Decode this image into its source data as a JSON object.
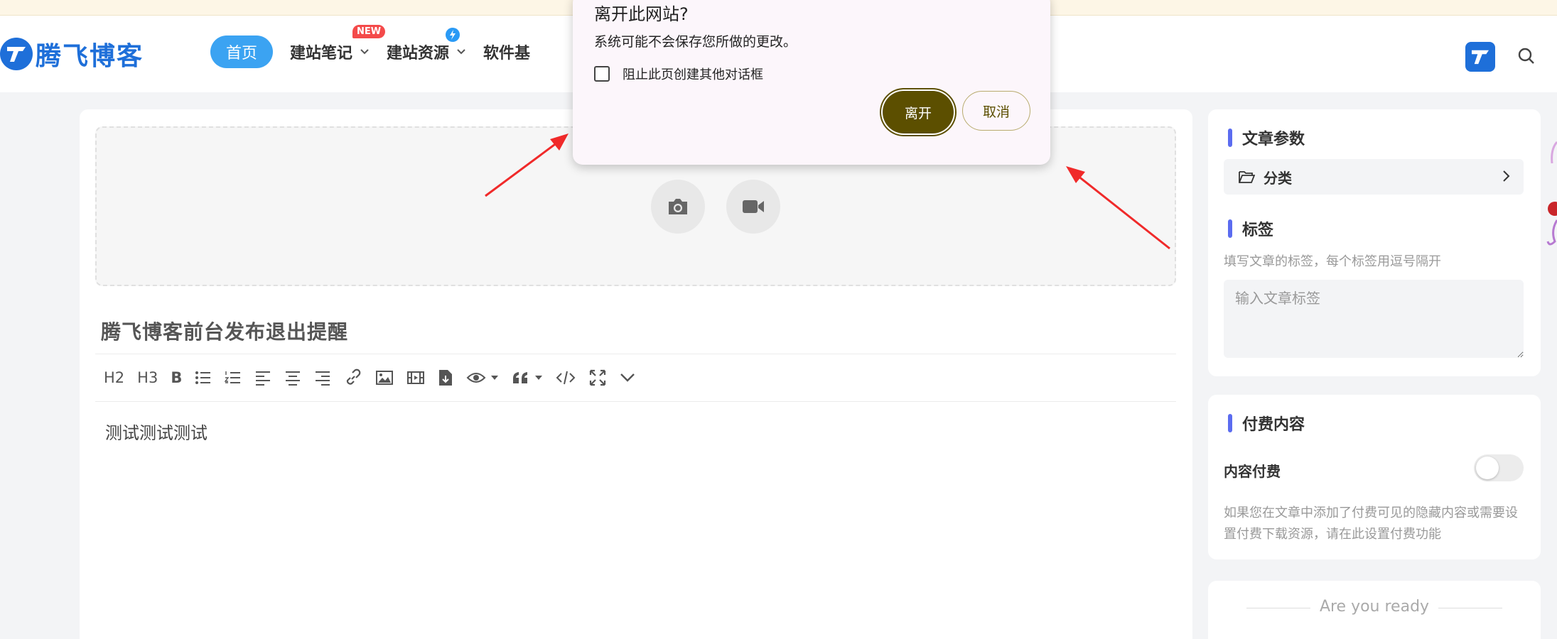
{
  "header": {
    "logo_text": "腾飞博客",
    "nav": {
      "home": "首页",
      "items": [
        {
          "label": "建站笔记",
          "badge": "NEW"
        },
        {
          "label": "建站资源"
        },
        {
          "label": "软件基"
        }
      ]
    }
  },
  "editor": {
    "post_title": "腾飞博客前台发布退出提醒",
    "toolbar": {
      "h2": "H2",
      "h3": "H3",
      "bold": "B"
    },
    "content": "测试测试测试"
  },
  "sidebar": {
    "article_params": {
      "title": "文章参数",
      "category_label": "分类"
    },
    "tags": {
      "title": "标签",
      "hint": "填写文章的标签，每个标签用逗号隔开",
      "placeholder": "输入文章标签"
    },
    "paid": {
      "title": "付费内容",
      "toggle_label": "内容付费",
      "toggle_on": false,
      "description": "如果您在文章中添加了付费可见的隐藏内容或需要设置付费下载资源，请在此设置付费功能"
    },
    "ready_text": "Are you ready"
  },
  "dialog": {
    "title": "离开此网站?",
    "message": "系统可能不会保存您所做的更改。",
    "checkbox_label": "阻止此页创建其他对话框",
    "checkbox_checked": false,
    "leave_button": "离开",
    "cancel_button": "取消"
  },
  "colors": {
    "brand_blue": "#1e6fd9",
    "nav_home_bg": "#3ba3f2",
    "accent_bar": "#5b6cf0",
    "dialog_primary": "#5c4f00",
    "annotation_arrow": "#f02a2a"
  }
}
